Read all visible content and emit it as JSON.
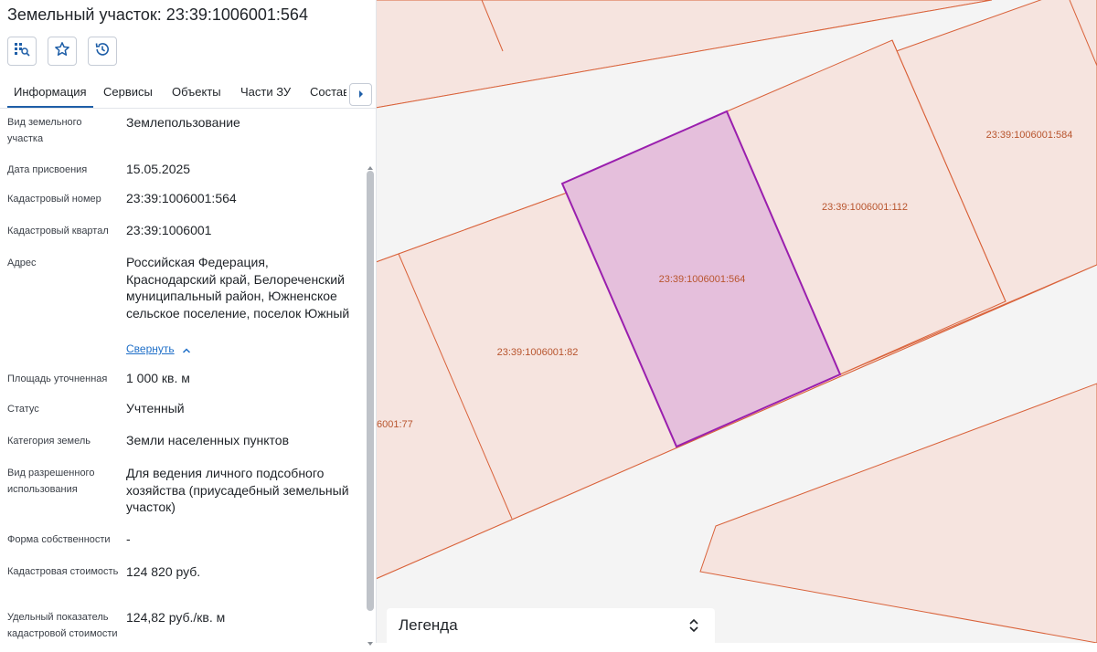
{
  "panel": {
    "title": "Земельный участок: 23:39:1006001:564",
    "actions": [
      {
        "name": "locate-on-map",
        "icon": "map-search-icon"
      },
      {
        "name": "favorite",
        "icon": "star-icon"
      },
      {
        "name": "history",
        "icon": "history-icon"
      }
    ],
    "tabs": [
      {
        "label": "Информация",
        "active": true
      },
      {
        "label": "Сервисы",
        "active": false
      },
      {
        "label": "Объекты",
        "active": false
      },
      {
        "label": "Части ЗУ",
        "active": false
      },
      {
        "label": "Состав",
        "active": false
      }
    ],
    "collapse_label": "Свернуть",
    "rows": [
      {
        "label": "Вид земельного участка",
        "value": "Землепользование"
      },
      {
        "label": "Дата присвоения",
        "value": "15.05.2025"
      },
      {
        "label": "Кадастровый номер",
        "value": "23:39:1006001:564"
      },
      {
        "label": "Кадастровый квартал",
        "value": "23:39:1006001"
      },
      {
        "label": "Адрес",
        "value": "Российская Федерация, Краснодарский край, Белореченский муниципальный район, Южненское сельское поселение, поселок Южный"
      },
      {
        "label": "Площадь уточненная",
        "value": "1 000 кв. м"
      },
      {
        "label": "Статус",
        "value": "Учтенный"
      },
      {
        "label": "Категория земель",
        "value": "Земли населенных пунктов"
      },
      {
        "label": "Вид разрешенного использования",
        "value": "Для ведения личного подсобного хозяйства (приусадебный земельный участок)"
      },
      {
        "label": "Форма собственности",
        "value": "-"
      },
      {
        "label": "Кадастровая стоимость",
        "value": "124 820 руб."
      },
      {
        "label": "Удельный показатель кадастровой стоимости",
        "value": "124,82 руб./кв. м"
      }
    ]
  },
  "map": {
    "parcels": [
      {
        "label": "23:39:1006001:564",
        "selected": true
      },
      {
        "label": "23:39:1006001:112",
        "selected": false
      },
      {
        "label": "23:39:1006001:584",
        "selected": false
      },
      {
        "label": "23:39:1006001:82",
        "selected": false
      },
      {
        "label": "6001:77",
        "selected": false
      }
    ],
    "colors": {
      "parcel_fill": "#f6e4df",
      "parcel_stroke": "#d9623a",
      "parcel_label": "#b8552e",
      "selected_fill": "#e5bfdc",
      "selected_stroke": "#9a1fae",
      "road": "#f4f4f4"
    }
  },
  "legend": {
    "title": "Легенда",
    "icon": "chevron-up-down-icon"
  }
}
